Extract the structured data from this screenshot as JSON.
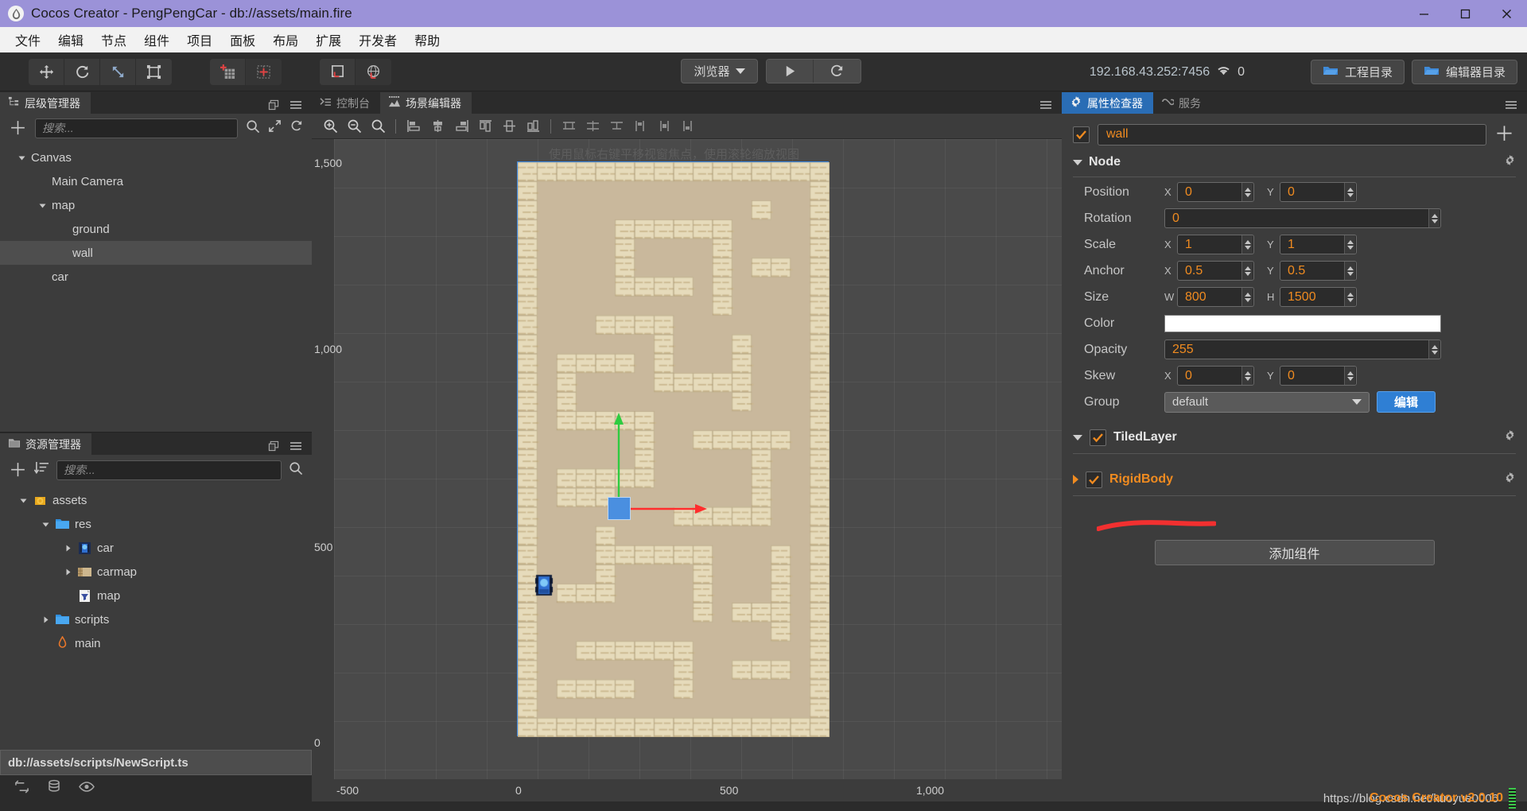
{
  "window": {
    "title": "Cocos Creator - PengPengCar - db://assets/main.fire",
    "logo": "cocos-drop-logo",
    "minimize": "minimize-icon",
    "maximize": "maximize-icon",
    "close": "close-icon"
  },
  "menubar": {
    "items": [
      {
        "label": "文件"
      },
      {
        "label": "编辑"
      },
      {
        "label": "节点"
      },
      {
        "label": "组件"
      },
      {
        "label": "项目"
      },
      {
        "label": "面板"
      },
      {
        "label": "布局"
      },
      {
        "label": "扩展"
      },
      {
        "label": "开发者"
      },
      {
        "label": "帮助"
      }
    ]
  },
  "toolbar": {
    "transform_tools": [
      "move-tool-icon",
      "rotate-tool-icon",
      "scale-tool-icon",
      "rect-tool-icon"
    ],
    "pivot_tools": [
      "pivot-icon",
      "grid-snap-icon"
    ],
    "coord_tools": [
      "local-coord-icon",
      "global-coord-icon"
    ],
    "browser_label": "浏览器",
    "browser_caret": "chevron-down-icon",
    "play_icon": "play-icon",
    "refresh_icon": "refresh-icon",
    "ip_address": "192.168.43.252:7456",
    "wifi_icon": "wifi-icon",
    "device_count": "0",
    "project_dir_label": "工程目录",
    "editor_dir_label": "编辑器目录",
    "folder_icon": "folder-icon"
  },
  "hierarchy": {
    "tab_label": "层级管理器",
    "tab_icon": "hierarchy-icon",
    "dock_icon": "dock-icon",
    "menu_icon": "hamburger-icon",
    "add_icon": "plus-icon",
    "search_placeholder": "搜索...",
    "search_value": "",
    "search_icon": "search-icon",
    "expand_icon": "expand-icon",
    "refresh_icon": "refresh-icon",
    "nodes": [
      {
        "label": "Canvas",
        "depth": 0,
        "caret": "down",
        "selected": false
      },
      {
        "label": "Main Camera",
        "depth": 1,
        "caret": "none",
        "selected": false
      },
      {
        "label": "map",
        "depth": 1,
        "caret": "down",
        "selected": false
      },
      {
        "label": "ground",
        "depth": 2,
        "caret": "none",
        "selected": false
      },
      {
        "label": "wall",
        "depth": 2,
        "caret": "none",
        "selected": true
      },
      {
        "label": "car",
        "depth": 1,
        "caret": "none",
        "selected": false
      }
    ]
  },
  "assets": {
    "tab_label": "资源管理器",
    "tab_icon": "folder-panel-icon",
    "dock_icon": "dock-icon",
    "menu_icon": "hamburger-icon",
    "add_icon": "plus-icon",
    "sort_icon": "sort-icon",
    "search_placeholder": "搜索...",
    "search_value": "",
    "search_icon": "search-icon",
    "items": [
      {
        "label": "assets",
        "depth": 0,
        "caret": "down",
        "icon": "assets-db-icon"
      },
      {
        "label": "res",
        "depth": 1,
        "caret": "down",
        "icon": "folder-icon"
      },
      {
        "label": "car",
        "depth": 2,
        "caret": "right",
        "icon": "sprite-car-icon"
      },
      {
        "label": "carmap",
        "depth": 2,
        "caret": "right",
        "icon": "tilemap-icon"
      },
      {
        "label": "map",
        "depth": 2,
        "caret": "none",
        "icon": "tmx-map-icon"
      },
      {
        "label": "scripts",
        "depth": 1,
        "caret": "right",
        "icon": "folder-icon"
      },
      {
        "label": "main",
        "depth": 1,
        "caret": "none",
        "icon": "scene-fire-icon"
      }
    ]
  },
  "statusbar": {
    "path": "db://assets/scripts/NewScript.ts",
    "icons": [
      "sync-icon",
      "database-icon",
      "eye-icon"
    ]
  },
  "scene": {
    "tabs": [
      {
        "label": "控制台",
        "icon": "console-icon",
        "active": false
      },
      {
        "label": "场景编辑器",
        "icon": "scene-icon",
        "active": true
      }
    ],
    "menu_icon": "hamburger-icon",
    "tool_icons": [
      "zoom-in-icon",
      "zoom-out-icon",
      "zoom-reset-icon",
      "separator",
      "align-left-icon",
      "align-center-h-icon",
      "align-right-icon",
      "align-top-icon",
      "align-middle-v-icon",
      "align-bottom-icon",
      "separator",
      "dist-left-icon",
      "dist-center-icon",
      "dist-right-icon",
      "dist-top-icon",
      "dist-middle-icon",
      "dist-bottom-icon"
    ],
    "hint": "使用鼠标右键平移视窗焦点，使用滚轮缩放视图",
    "ruler_v": [
      "1,500",
      "1,000",
      "500",
      "0"
    ],
    "ruler_h": [
      "-500",
      "0",
      "500",
      "1,000"
    ],
    "gizmo": {
      "y_axis_color": "#2ecc40",
      "x_axis_color": "#ff2d2d",
      "anchor_color": "#4a8fe0"
    },
    "selection_outline_color": "#3d8ae5"
  },
  "inspector": {
    "tabs": [
      {
        "label": "属性检查器",
        "icon": "gear-icon",
        "active": true
      },
      {
        "label": "服务",
        "icon": "service-icon",
        "active": false
      }
    ],
    "menu_icon": "hamburger-icon",
    "node_enabled": true,
    "node_name": "wall",
    "add_icon": "plus-icon",
    "node_section": {
      "title": "Node",
      "gear_icon": "gear-icon",
      "properties": [
        {
          "label": "Position",
          "type": "xy",
          "x_label": "X",
          "y_label": "Y",
          "x": "0",
          "y": "0"
        },
        {
          "label": "Rotation",
          "type": "single",
          "value": "0"
        },
        {
          "label": "Scale",
          "type": "xy",
          "x_label": "X",
          "y_label": "Y",
          "x": "1",
          "y": "1"
        },
        {
          "label": "Anchor",
          "type": "xy",
          "x_label": "X",
          "y_label": "Y",
          "x": "0.5",
          "y": "0.5"
        },
        {
          "label": "Size",
          "type": "xy",
          "x_label": "W",
          "y_label": "H",
          "x": "800",
          "y": "1500"
        },
        {
          "label": "Color",
          "type": "color",
          "value": "#ffffff"
        },
        {
          "label": "Opacity",
          "type": "single",
          "value": "255"
        },
        {
          "label": "Skew",
          "type": "xy",
          "x_label": "X",
          "y_label": "Y",
          "x": "0",
          "y": "0"
        },
        {
          "label": "Group",
          "type": "select",
          "value": "default",
          "button": "编辑"
        }
      ]
    },
    "components": [
      {
        "name": "TiledLayer",
        "enabled": true,
        "expanded": true,
        "color": "#e6e6e6",
        "gear_icon": "gear-icon"
      },
      {
        "name": "RigidBody",
        "enabled": true,
        "expanded": false,
        "color": "#f08b20",
        "gear_icon": "gear-icon"
      }
    ],
    "annotation_color": "#f23030",
    "add_component_label": "添加组件"
  },
  "watermark": {
    "blog_url": "https://blog.csdn.net/kuoyue0006",
    "version": "Cocos Creator v2.0.10"
  },
  "colors": {
    "titlebar": "#9b92d8",
    "accent_blue": "#2a6db5",
    "value_orange": "#f08b20",
    "panel_bg": "#3c3c3c"
  }
}
